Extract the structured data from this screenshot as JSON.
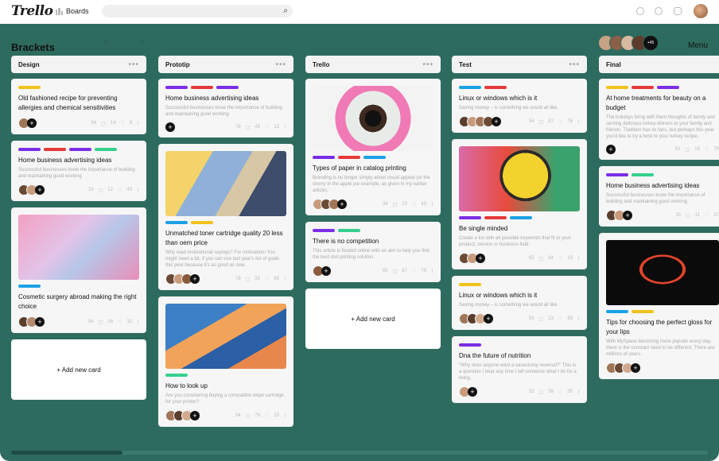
{
  "app": {
    "logo": "Trello",
    "boards_label": "Boards"
  },
  "board": {
    "title": "Brackets",
    "menu_label": "Menu",
    "more_members": "+45"
  },
  "colors": {
    "purple": "#7b2ee6",
    "red": "#e63a3a",
    "yellow": "#f2c21b",
    "blue": "#1aa1e6",
    "green": "#35d08e",
    "board_bg": "#2e6b5f"
  },
  "columns": [
    {
      "title": "Design",
      "cards": [
        {
          "title": "Old fashioned recipe for preventing allergies and chemical sensitivities",
          "desc": "",
          "stats": [
            "34",
            "14",
            "8"
          ]
        },
        {
          "title": "Home business advertising ideas",
          "desc": "Successful businesses know the importance of building and maintaining good working",
          "stats": [
            "23",
            "12",
            "43"
          ]
        },
        {
          "title": "Cosmetic surgery abroad making the right choice",
          "desc": "",
          "stats": [
            "54",
            "16",
            "32"
          ]
        }
      ],
      "add_label": "+ Add new card"
    },
    {
      "title": "Prototip",
      "cards": [
        {
          "title": "Home business advertising ideas",
          "desc": "Successful businesses know the importance of building and maintaining good working",
          "stats": [
            "76",
            "45",
            "12"
          ]
        },
        {
          "title": "Unmatched toner cartridge quality 20 less than oem price",
          "desc": "Why read motivational sayings? For motivation! You might need a bit, if you can use last year's list of goals this year because it's as good as new.",
          "stats": [
            "78",
            "32",
            "65"
          ]
        },
        {
          "title": "How to look up",
          "desc": "Are you considering buying a compatible inkjet cartridge for your printer?",
          "stats": [
            "54",
            "76",
            "15"
          ]
        }
      ]
    },
    {
      "title": "Trello",
      "cards": [
        {
          "title": "Types of paper in catalog printing",
          "desc": "Branding is no longer simply about visual appeal (or the cherry in the apple pie example, as given in my earlier article).",
          "stats": [
            "34",
            "23",
            "43"
          ]
        },
        {
          "title": "There is no competition",
          "desc": "This article is floated online with an aim to help you find the best dvd printing solution.",
          "stats": [
            "65",
            "87",
            "76"
          ]
        }
      ],
      "add_label": "+ Add new card"
    },
    {
      "title": "Test",
      "cards": [
        {
          "title": "Linux or windows which is it",
          "desc": "Saving money – is something we would all like.",
          "stats": [
            "54",
            "87",
            "76"
          ]
        },
        {
          "title": "Be single minded",
          "desc": "Create a list with all possible keywords that fit to your product, service or business field.",
          "stats": [
            "65",
            "34",
            "15"
          ]
        },
        {
          "title": "Linux or windows which is it",
          "desc": "Saving money – is something we would all like.",
          "stats": [
            "55",
            "23",
            "65"
          ]
        },
        {
          "title": "Dna the future of nutrition",
          "desc": "\"Why does anyone want a vasectomy reversal?\" This is a question I hear any time I tell someone what I do for a living.",
          "stats": [
            "32",
            "56",
            "35"
          ]
        }
      ]
    },
    {
      "title": "Final",
      "cards": [
        {
          "title": "At home treatments for beauty on a budget",
          "desc": "The holidays bring with them thoughts of family and serving delicious turkey dinners to your family and friends. Tradition has its fans, but perhaps this year you'd like to try a twist to your turkey recipe.",
          "stats": [
            "51",
            "16",
            "70"
          ]
        },
        {
          "title": "Home business advertising ideas",
          "desc": "Successful businesses know the importance of building and maintaining good working",
          "stats": [
            "15",
            "11",
            "27"
          ]
        },
        {
          "title": "Tips for choosing the perfect gloss for your lips",
          "desc": "With MySpace becoming more popular every day, there is the constant need to be different. There are millions of users.",
          "stats": [
            "",
            "",
            ""
          ]
        }
      ]
    }
  ]
}
